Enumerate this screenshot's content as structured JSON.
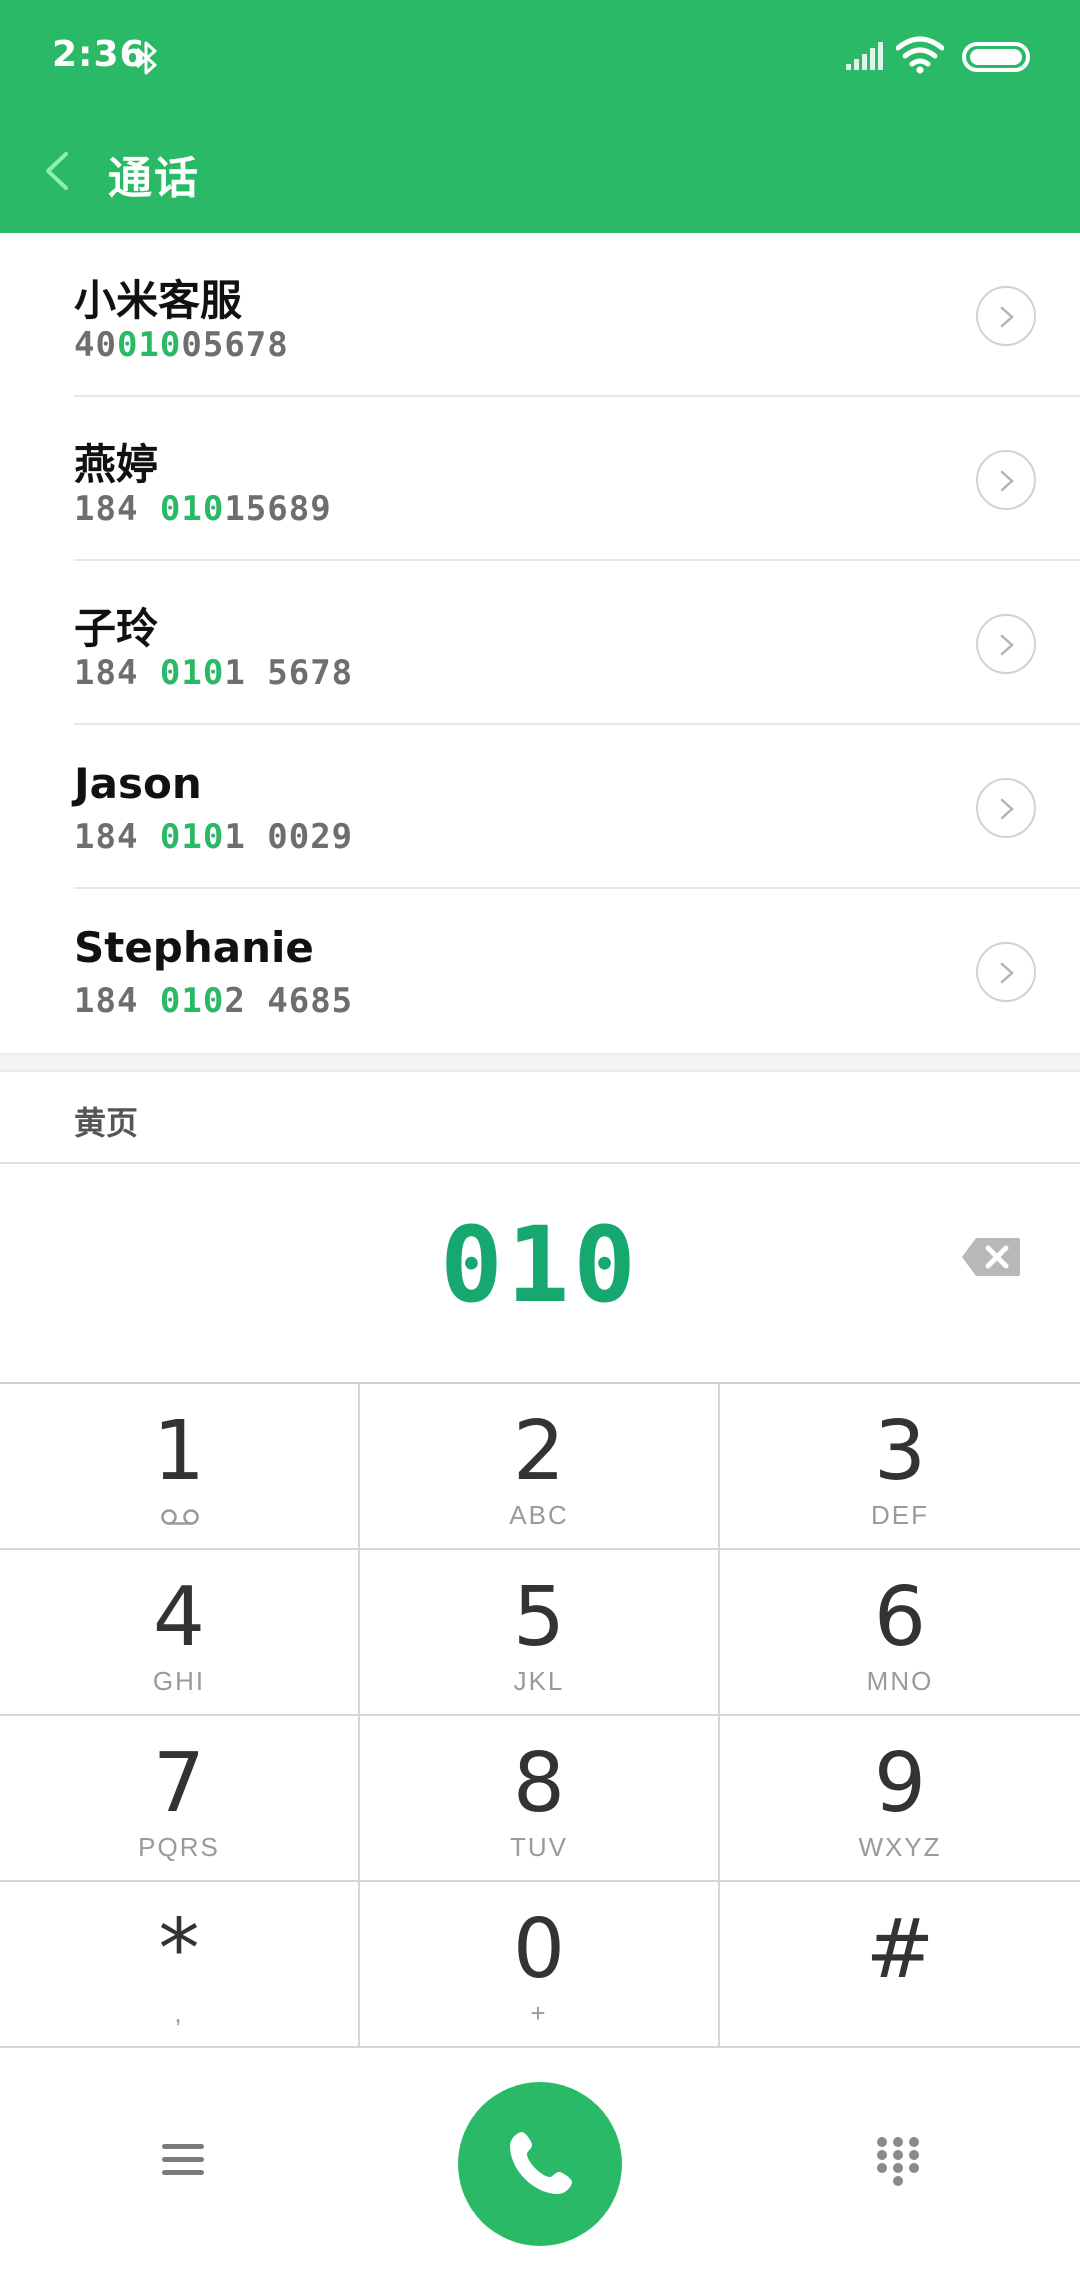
{
  "status_bar": {
    "time": "2:36",
    "bluetooth_icon": "bluetooth-icon",
    "signal_icon": "signal-icon",
    "wifi_icon": "wifi-icon",
    "battery_icon": "battery-icon"
  },
  "header": {
    "back_icon": "chevron-left-icon",
    "title": "通话",
    "background_color": "#2ab966"
  },
  "contacts": [
    {
      "name": "小米客服",
      "number_pre": "40",
      "number_match": "010",
      "number_post": "05678"
    },
    {
      "name": "燕婷",
      "number_pre": "184 ",
      "number_match": "010",
      "number_post": "15689"
    },
    {
      "name": "子玲",
      "number_pre": "184 ",
      "number_match": "010",
      "number_post": "1 5678"
    },
    {
      "name": "Jason",
      "number_pre": "184 ",
      "number_match": "010",
      "number_post": "1 0029"
    },
    {
      "name": "Stephanie",
      "number_pre": "184 ",
      "number_match": "010",
      "number_post": "2 4685"
    }
  ],
  "yellow_pages": {
    "label": "黄页"
  },
  "dial": {
    "number": "010",
    "backspace_icon": "backspace-icon",
    "number_color": "#16a86f"
  },
  "keypad": {
    "keys": [
      {
        "digit": "1",
        "letters": "",
        "sub_icon": "voicemail-icon"
      },
      {
        "digit": "2",
        "letters": "ABC"
      },
      {
        "digit": "3",
        "letters": "DEF"
      },
      {
        "digit": "4",
        "letters": "GHI"
      },
      {
        "digit": "5",
        "letters": "JKL"
      },
      {
        "digit": "6",
        "letters": "MNO"
      },
      {
        "digit": "7",
        "letters": "PQRS"
      },
      {
        "digit": "8",
        "letters": "TUV"
      },
      {
        "digit": "9",
        "letters": "WXYZ"
      },
      {
        "digit": "*",
        "letters": ","
      },
      {
        "digit": "0",
        "letters": "+"
      },
      {
        "digit": "#",
        "letters": ""
      }
    ]
  },
  "bottom_bar": {
    "menu_icon": "menu-icon",
    "call_icon": "phone-icon",
    "keypad_icon": "dialpad-icon",
    "accent_color": "#2ab966"
  }
}
